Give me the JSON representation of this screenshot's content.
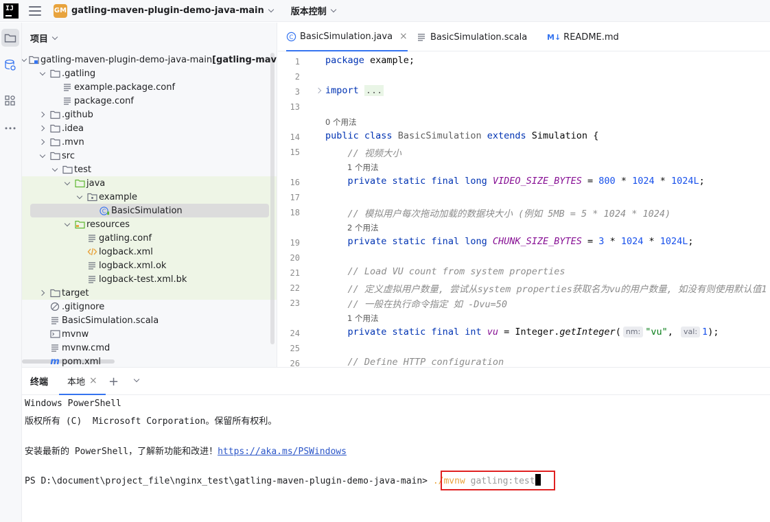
{
  "titlebar": {
    "logo_text": "IJ",
    "project_badge": "GM",
    "project_name": "gatling-maven-plugin-demo-java-main",
    "vcs_label": "版本控制"
  },
  "project_panel": {
    "title": "项目",
    "tree": [
      {
        "label": "gatling-maven-plugin-demo-java-main",
        "suffix": " [gatling-maven",
        "depth": 0,
        "arrow": "down",
        "icon": "module-folder-icon"
      },
      {
        "label": ".gatling",
        "depth": 1,
        "arrow": "down",
        "icon": "folder-icon"
      },
      {
        "label": "example.package.conf",
        "depth": 2,
        "arrow": "",
        "icon": "text-file-icon"
      },
      {
        "label": "package.conf",
        "depth": 2,
        "arrow": "",
        "icon": "text-file-icon"
      },
      {
        "label": ".github",
        "depth": 1,
        "arrow": "right",
        "icon": "folder-icon"
      },
      {
        "label": ".idea",
        "depth": 1,
        "arrow": "right",
        "icon": "folder-icon"
      },
      {
        "label": ".mvn",
        "depth": 1,
        "arrow": "right",
        "icon": "folder-icon"
      },
      {
        "label": "src",
        "depth": 1,
        "arrow": "down",
        "icon": "folder-icon"
      },
      {
        "label": "test",
        "depth": 2,
        "arrow": "down",
        "icon": "folder-icon"
      },
      {
        "label": "java",
        "depth": 3,
        "arrow": "down",
        "icon": "test-source-folder-icon",
        "hl": true
      },
      {
        "label": "example",
        "depth": 4,
        "arrow": "down",
        "icon": "package-icon",
        "hl": true
      },
      {
        "label": "BasicSimulation",
        "depth": 5,
        "arrow": "",
        "icon": "java-class-icon",
        "hl": true,
        "selected": true
      },
      {
        "label": "resources",
        "depth": 3,
        "arrow": "down",
        "icon": "test-resources-folder-icon",
        "hl": true
      },
      {
        "label": "gatling.conf",
        "depth": 4,
        "arrow": "",
        "icon": "text-file-icon",
        "hl": true
      },
      {
        "label": "logback.xml",
        "depth": 4,
        "arrow": "",
        "icon": "xml-file-icon",
        "hl": true
      },
      {
        "label": "logback.xml.ok",
        "depth": 4,
        "arrow": "",
        "icon": "text-file-icon",
        "hl": true
      },
      {
        "label": "logback-test.xml.bk",
        "depth": 4,
        "arrow": "",
        "icon": "text-file-icon",
        "hl": true
      },
      {
        "label": "target",
        "depth": 1,
        "arrow": "right",
        "icon": "folder-icon",
        "hl_target": true
      },
      {
        "label": ".gitignore",
        "depth": 1,
        "arrow": "",
        "icon": "ignore-file-icon"
      },
      {
        "label": "BasicSimulation.scala",
        "depth": 1,
        "arrow": "",
        "icon": "text-file-icon"
      },
      {
        "label": "mvnw",
        "depth": 1,
        "arrow": "",
        "icon": "shell-file-icon"
      },
      {
        "label": "mvnw.cmd",
        "depth": 1,
        "arrow": "",
        "icon": "text-file-icon"
      },
      {
        "label": "pom.xml",
        "depth": 1,
        "arrow": "",
        "icon": "maven-file-icon"
      }
    ]
  },
  "editor": {
    "tabs": [
      {
        "label": "BasicSimulation.java",
        "icon": "java-class-icon",
        "active": true,
        "close": "×"
      },
      {
        "label": "BasicSimulation.scala",
        "icon": "text-file-icon",
        "active": false
      },
      {
        "label": "README.md",
        "icon": "markdown-icon",
        "icon_text": "M↓",
        "active": false
      }
    ],
    "line_numbers": [
      "1",
      "2",
      "3",
      "13",
      "14",
      "15",
      "16",
      "17",
      "18",
      "19",
      "20",
      "21",
      "22",
      "23",
      "24",
      "25",
      "26"
    ],
    "usage_hints": [
      "0 个用法",
      "1 个用法",
      "2 个用法",
      "1 个用法"
    ],
    "code": {
      "l1_kw": "package",
      "l1_rest": " example;",
      "l3_kw": "import",
      "l3_fold": "...",
      "l14_kw": "public class",
      "l14_cls": "BasicSimulation",
      "l14_kw2": "extends",
      "l14_rest": " Simulation {",
      "l15_cmt": "// 视频大小",
      "l16_kw": "private static final long",
      "l16_const": "VIDEO_SIZE_BYTES",
      "l16_eq": " = ",
      "l16_n1": "800",
      "l16_op1": " * ",
      "l16_n2": "1024",
      "l16_op2": " * ",
      "l16_n3": "1024L",
      "l16_end": ";",
      "l18_cmt": "// 模拟用户每次拖动加载的数据块大小 (例如 5MB = 5 * 1024 * 1024)",
      "l19_kw": "private static final long",
      "l19_const": "CHUNK_SIZE_BYTES",
      "l19_eq": " = ",
      "l19_n1": "3",
      "l19_op1": " * ",
      "l19_n2": "1024",
      "l19_op2": " * ",
      "l19_n3": "1024L",
      "l19_end": ";",
      "l21_cmt": "// Load VU count from system properties",
      "l22_cmt": "// 定义虚拟用户数量, 尝试从system properties获取名为vu的用户数量, 如没有则使用默认值1",
      "l23_cmt": "// 一般在执行命令指定 如 -Dvu=50",
      "l24_kw": "private static final int",
      "l24_const": "vu",
      "l24_eq": " = Integer.",
      "l24_mth": "getInteger",
      "l24_open": "(",
      "l24_hint1": "nm:",
      "l24_str": "\"vu\"",
      "l24_comma": ",",
      "l24_hint2": "val:",
      "l24_num": "1",
      "l24_end": ");",
      "l26_cmt": "// Define HTTP configuration"
    }
  },
  "terminal": {
    "title": "终端",
    "tab_label": "本地",
    "tab_close": "×",
    "plus": "+",
    "lines": [
      "Windows PowerShell",
      "版权所有 (C)  Microsoft Corporation。保留所有权利。",
      "",
      "安装最新的 PowerShell，了解新功能和改进！",
      "",
      "PS D:\\document\\project_file\\nginx_test\\gatling-maven-plugin-demo-java-main> "
    ],
    "link": "https://aka.ms/PSWindows",
    "cmd_part1": "./mvnw",
    "cmd_part2": " gatling:test"
  },
  "colors": {
    "accent": "#3574f0",
    "highlight_box": "#e02020",
    "test_source_bg": "#eef5e6"
  }
}
